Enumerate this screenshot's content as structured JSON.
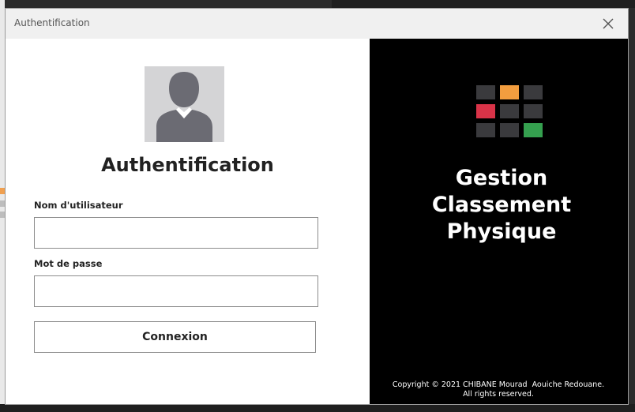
{
  "window": {
    "title": "Authentification",
    "close_icon": "close-icon"
  },
  "login": {
    "avatar_icon": "user-avatar-icon",
    "heading": "Authentification",
    "username_label": "Nom d'utilisateur",
    "username_value": "",
    "password_label": "Mot de passe",
    "password_value": "",
    "submit_label": "Connexion"
  },
  "branding": {
    "logo_icon": "grid-logo-icon",
    "app_title_line1": "Gestion",
    "app_title_line2": "Classement",
    "app_title_line3": "Physique",
    "copyright_line1": "Copyright © 2021 CHIBANE Mourad  Aouiche Redouane.",
    "copyright_line2": "All rights reserved."
  },
  "colors": {
    "panel_dark": "#000000",
    "logo_gray": "#3a3a3d",
    "logo_orange": "#f29d3f",
    "logo_red": "#d93348",
    "logo_green": "#35a04f"
  }
}
